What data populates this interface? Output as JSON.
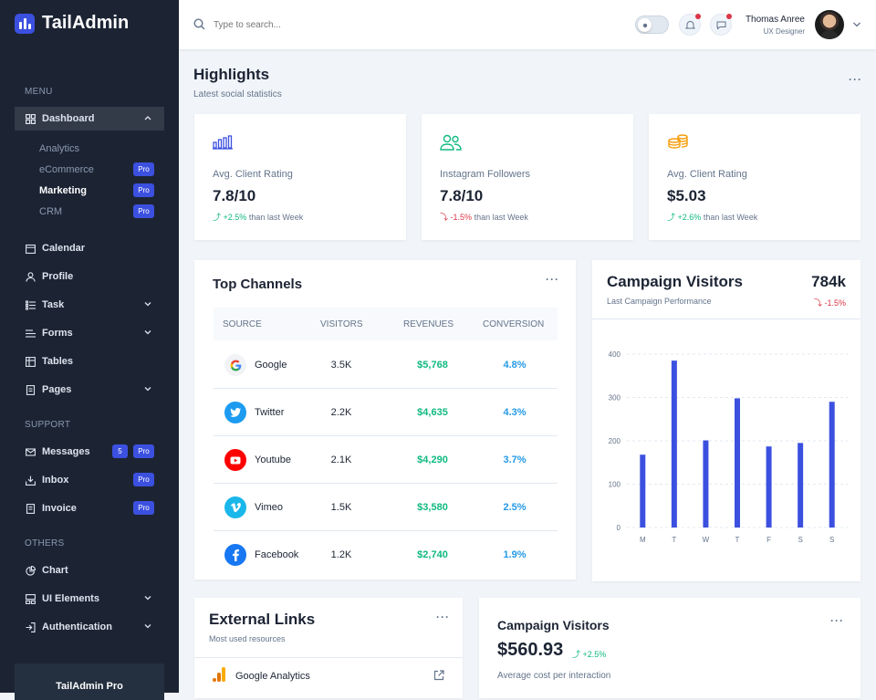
{
  "app": {
    "name": "TailAdmin"
  },
  "sidebar": {
    "menu_title": "MENU",
    "dashboard": "Dashboard",
    "sub_items": [
      {
        "label": "Analytics",
        "badge": ""
      },
      {
        "label": "eCommerce",
        "badge": "Pro"
      },
      {
        "label": "Marketing",
        "badge": "Pro"
      },
      {
        "label": "CRM",
        "badge": "Pro"
      }
    ],
    "items": [
      "Calendar",
      "Profile",
      "Task",
      "Forms",
      "Tables",
      "Pages"
    ],
    "support_title": "SUPPORT",
    "support": [
      {
        "label": "Messages",
        "count": "5",
        "badge": "Pro"
      },
      {
        "label": "Inbox",
        "badge": "Pro"
      },
      {
        "label": "Invoice",
        "badge": "Pro"
      }
    ],
    "others_title": "OTHERS",
    "others": [
      "Chart",
      "UI Elements",
      "Authentication"
    ],
    "promo": "TailAdmin Pro"
  },
  "header": {
    "search_placeholder": "Type to search...",
    "user_name": "Thomas Anree",
    "user_role": "UX Designer"
  },
  "highlights": {
    "title": "Highlights",
    "subtitle": "Latest social statistics",
    "stats": [
      {
        "label": "Avg. Client Rating",
        "value": "7.8/10",
        "trend": "+2.5%",
        "trend_dir": "up",
        "suffix": "than last Week"
      },
      {
        "label": "Instagram Followers",
        "value": "7.8/10",
        "trend": "-1.5%",
        "trend_dir": "down",
        "suffix": "than last Week"
      },
      {
        "label": "Avg. Client Rating",
        "value": "$5.03",
        "trend": "+2.6%",
        "trend_dir": "up",
        "suffix": "than last Week"
      }
    ]
  },
  "channels": {
    "title": "Top Channels",
    "columns": [
      "SOURCE",
      "VISITORS",
      "REVENUES",
      "CONVERSION"
    ],
    "rows": [
      {
        "source": "Google",
        "visitors": "3.5K",
        "revenue": "$5,768",
        "conversion": "4.8%"
      },
      {
        "source": "Twitter",
        "visitors": "2.2K",
        "revenue": "$4,635",
        "conversion": "4.3%"
      },
      {
        "source": "Youtube",
        "visitors": "2.1K",
        "revenue": "$4,290",
        "conversion": "3.7%"
      },
      {
        "source": "Vimeo",
        "visitors": "1.5K",
        "revenue": "$3,580",
        "conversion": "2.5%"
      },
      {
        "source": "Facebook",
        "visitors": "1.2K",
        "revenue": "$2,740",
        "conversion": "1.9%"
      }
    ]
  },
  "campaign": {
    "title": "Campaign Visitors",
    "subtitle": "Last Campaign Performance",
    "total": "784k",
    "change": "-1.5%"
  },
  "chart_data": {
    "type": "bar",
    "categories": [
      "M",
      "T",
      "W",
      "T",
      "F",
      "S",
      "S"
    ],
    "values": [
      168,
      385,
      201,
      298,
      187,
      195,
      290
    ],
    "y_ticks": [
      "0",
      "100",
      "200",
      "300",
      "400"
    ],
    "ylim": [
      0,
      400
    ],
    "grid": true,
    "color": "#3c50e0"
  },
  "external_links": {
    "title": "External Links",
    "subtitle": "Most used resources",
    "items": [
      {
        "label": "Google Analytics"
      }
    ]
  },
  "campaign_cost": {
    "title": "Campaign Visitors",
    "value": "$560.93",
    "change": "+2.5%",
    "subtitle": "Average cost per interaction"
  }
}
